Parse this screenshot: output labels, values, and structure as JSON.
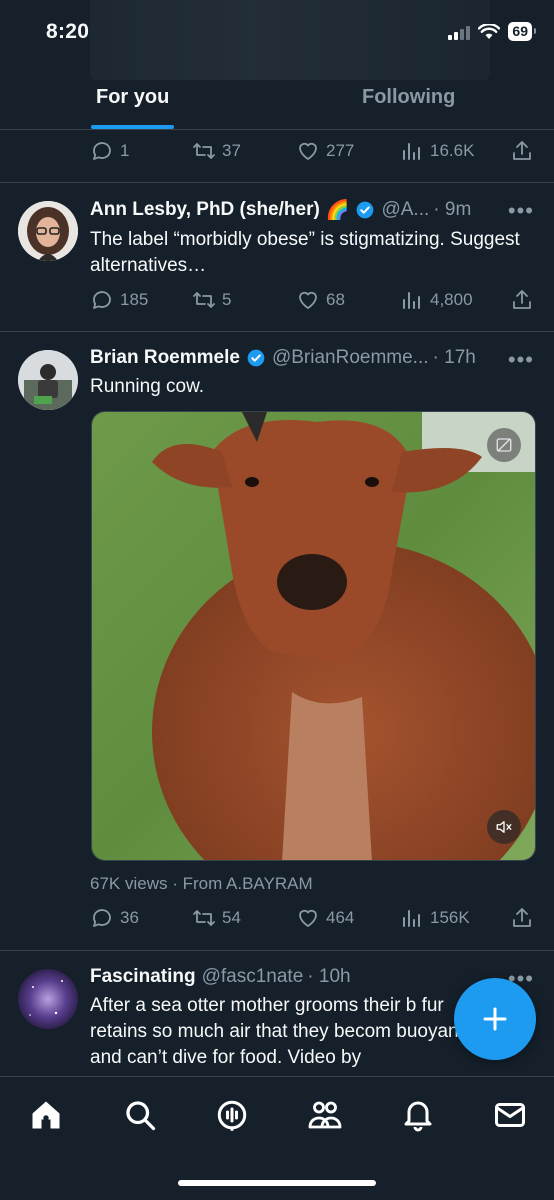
{
  "status_bar": {
    "time": "8:20",
    "battery": "69"
  },
  "tabs": [
    {
      "label": "For you",
      "active": true
    },
    {
      "label": "Following",
      "active": false
    }
  ],
  "top_partial_tweet": {
    "replies": "1",
    "retweets": "37",
    "likes": "277",
    "views": "16.6K"
  },
  "tweets": [
    {
      "name": "Ann Lesby, PhD (she/her)",
      "emoji": "🌈",
      "verified": true,
      "handle": "@A...",
      "time": "· 9m",
      "text": "The label “morbidly obese” is stigmatizing. Suggest alternatives…",
      "replies": "185",
      "retweets": "5",
      "likes": "68",
      "views": "4,800"
    },
    {
      "name": "Brian Roemmele",
      "verified": true,
      "handle": "@BrianRoemme...",
      "time": "· 17h",
      "text": "Running cow.",
      "views_line": "67K views · From A.BAYRAM",
      "replies": "36",
      "retweets": "54",
      "likes": "464",
      "views": "156K"
    },
    {
      "name": "Fascinating",
      "handle": "@fasc1nate",
      "time": "· 10h",
      "text": "After a sea otter mother grooms their b fur retains so much air that they becom buoyant and can’t dive for food. Video by"
    }
  ],
  "more_label": "•••",
  "colors": {
    "accent": "#1d9bf0",
    "background": "#15202b",
    "muted": "#8b98a5"
  },
  "nav": [
    "home-icon",
    "search-icon",
    "spaces-icon",
    "communities-icon",
    "notifications-icon",
    "messages-icon"
  ]
}
